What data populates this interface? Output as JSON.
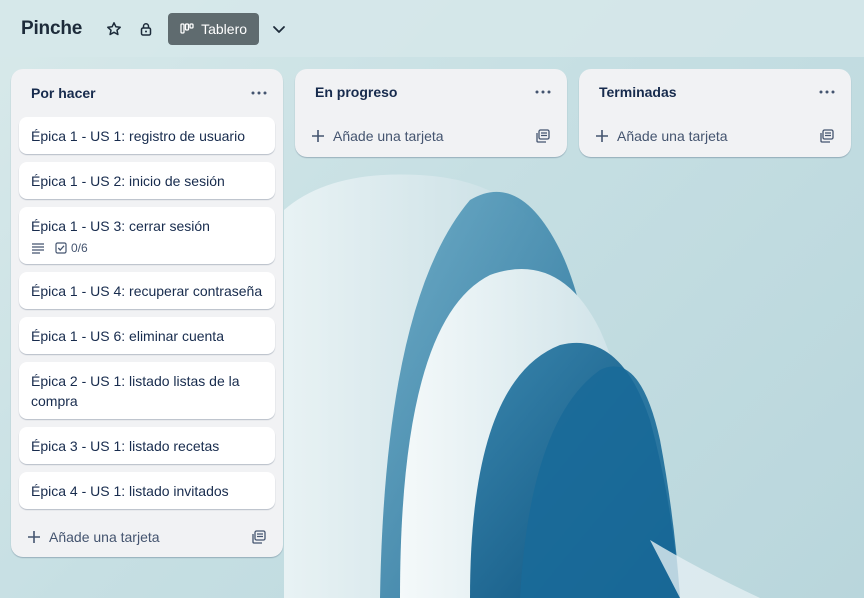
{
  "board": {
    "title": "Pinche",
    "view_label": "Tablero",
    "icons": [
      "star-icon",
      "lock-icon",
      "board-view-icon",
      "chevron-down-icon"
    ]
  },
  "lists": [
    {
      "title": "Por hacer",
      "add_label": "Añade una tarjeta",
      "cards": [
        {
          "title": "Épica 1 - US 1: registro de usuario"
        },
        {
          "title": "Épica 1 - US 2: inicio de sesión"
        },
        {
          "title": "Épica 1 - US 3: cerrar sesión",
          "checklist": "0/6",
          "has_description": true
        },
        {
          "title": "Épica 1 - US 4: recuperar contraseña"
        },
        {
          "title": "Épica 1 - US 6: eliminar cuenta"
        },
        {
          "title": "Épica 2 - US 1: listado listas de la compra"
        },
        {
          "title": "Épica 3 - US 1: listado recetas"
        },
        {
          "title": "Épica 4 - US 1: listado invitados"
        }
      ]
    },
    {
      "title": "En progreso",
      "add_label": "Añade una tarjeta",
      "cards": []
    },
    {
      "title": "Terminadas",
      "add_label": "Añade una tarjeta",
      "cards": []
    }
  ],
  "colors": {
    "header_bg": "#d6e8ea",
    "view_button_bg": "#5f6b6f",
    "list_bg": "#f1f2f4",
    "card_bg": "#ffffff",
    "text_primary": "#172b4d",
    "text_secondary": "#44546f"
  }
}
